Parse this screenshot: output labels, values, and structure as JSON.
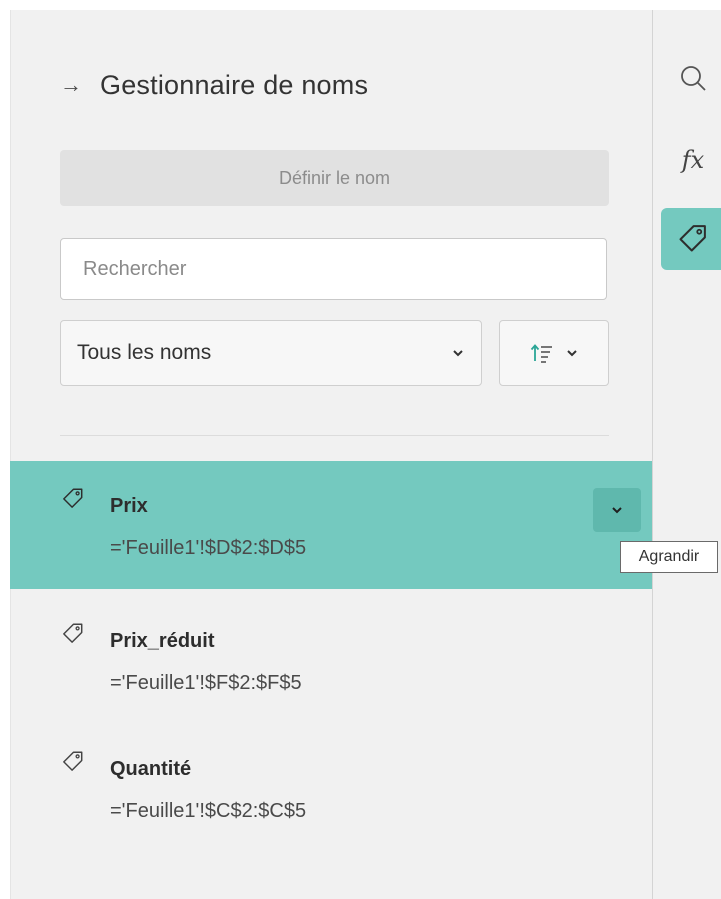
{
  "panel": {
    "title": "Gestionnaire de noms",
    "define_button": "Définir le nom",
    "search_placeholder": "Rechercher",
    "filter_value": "Tous les noms"
  },
  "names": [
    {
      "name": "Prix",
      "formula": "='Feuille1'!$D$2:$D$5",
      "selected": true
    },
    {
      "name": "Prix_réduit",
      "formula": "='Feuille1'!$F$2:$F$5",
      "selected": false
    },
    {
      "name": "Quantité",
      "formula": "='Feuille1'!$C$2:$C$5",
      "selected": false
    }
  ],
  "tooltip": "Agrandir",
  "rail": {
    "fx_label": "fx"
  },
  "icons": [
    "arrow-right-icon",
    "chevron-down-icon",
    "sort-ascending-icon",
    "tag-icon",
    "search-icon",
    "function-icon"
  ],
  "colors": {
    "accent": "#74c9bf",
    "accent_dark": "#5fb8ad",
    "panel_bg": "#f1f1f1"
  }
}
